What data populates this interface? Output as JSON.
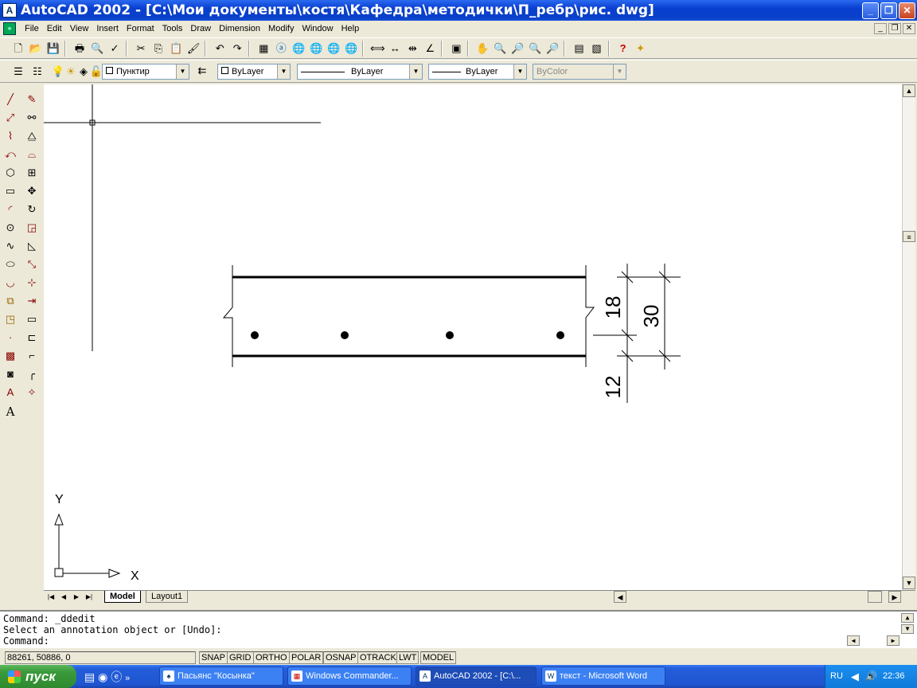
{
  "window": {
    "title": "AutoCAD 2002 - [C:\\Мои документы\\костя\\Кафедра\\методички\\П_ребр\\рис. dwg]",
    "app_icon": "A",
    "doc_icon": "⌖"
  },
  "menu": [
    "File",
    "Edit",
    "View",
    "Insert",
    "Format",
    "Tools",
    "Draw",
    "Dimension",
    "Modify",
    "Window",
    "Help"
  ],
  "toolbar2": {
    "layer_value": "Пунктир",
    "color_value": "ByLayer",
    "linetype_value": "ByLayer",
    "lineweight_value": "ByLayer",
    "plotstyle_value": "ByColor"
  },
  "drawing": {
    "dim_labels": [
      "18",
      "30",
      "12"
    ],
    "ucs_x": "X",
    "ucs_y": "Y"
  },
  "layout_tabs": [
    "Model",
    "Layout1"
  ],
  "command_lines": [
    "Command: _ddedit",
    "Select an annotation object or [Undo]:",
    "Command:"
  ],
  "status": {
    "coords": "88261, 50886, 0",
    "toggles": [
      "SNAP",
      "GRID",
      "ORTHO",
      "POLAR",
      "OSNAP",
      "OTRACK",
      "LWT",
      "MODEL"
    ]
  },
  "taskbar": {
    "start_label": "пуск",
    "tasks": [
      "Пасьянс \"Косынка\"",
      "Windows Commander...",
      "AutoCAD 2002 - [C:\\...",
      "текст - Microsoft Word"
    ],
    "lang": "RU",
    "time": "22:36"
  },
  "colors": {
    "title_blue": "#0a3fd0",
    "taskbar_blue": "#245edb",
    "start_green": "#3a9a3a"
  }
}
